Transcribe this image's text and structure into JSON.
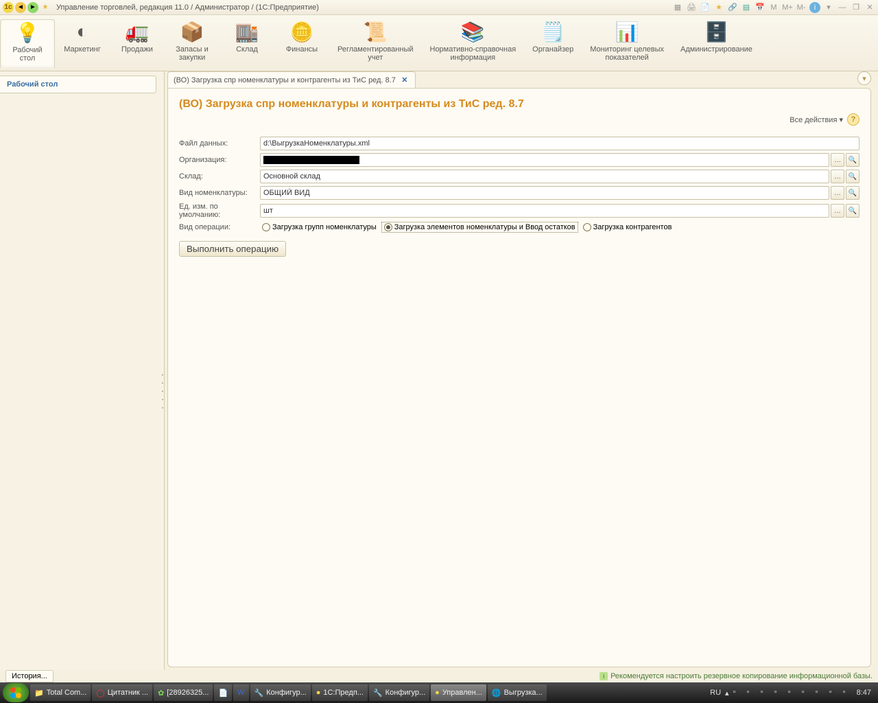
{
  "titlebar": {
    "title": "Управление торговлей, редакция 11.0 / Администратор / (1С:Предприятие)",
    "m_buttons": [
      "M",
      "M+",
      "M-"
    ]
  },
  "ribbon": [
    {
      "label": "Рабочий\nстол",
      "icon": "🔵",
      "active": true
    },
    {
      "label": "Маркетинг",
      "icon": "📊"
    },
    {
      "label": "Продажи",
      "icon": "🚚"
    },
    {
      "label": "Запасы и\nзакупки",
      "icon": "📦"
    },
    {
      "label": "Склад",
      "icon": "🏢"
    },
    {
      "label": "Финансы",
      "icon": "💰"
    },
    {
      "label": "Регламентированный\nучет",
      "icon": "📋"
    },
    {
      "label": "Нормативно-справочная\nинформация",
      "icon": "📚"
    },
    {
      "label": "Органайзер",
      "icon": "📝"
    },
    {
      "label": "Мониторинг целевых\nпоказателей",
      "icon": "📈"
    },
    {
      "label": "Администрирование",
      "icon": "🗄️"
    }
  ],
  "sidebar": {
    "active_tab": "Рабочий стол"
  },
  "tab": {
    "title": "(ВО) Загрузка спр номенклатуры и контрагенты из ТиС ред. 8.7"
  },
  "form": {
    "heading": "(ВО) Загрузка спр номенклатуры и контрагенты из ТиС ред. 8.7",
    "all_actions": "Все действия",
    "labels": {
      "file": "Файл данных:",
      "org": "Организация:",
      "warehouse": "Склад:",
      "nomenclature_type": "Вид номенклатуры:",
      "default_unit": "Ед. изм. по умолчанию:",
      "operation_type": "Вид операции:"
    },
    "values": {
      "file": "d:\\ВыгрузкаНоменклатуры.xml",
      "org": "",
      "warehouse": "Основной склад",
      "nomenclature_type": "ОБЩИЙ ВИД",
      "default_unit": "шт"
    },
    "radios": {
      "r1": "Загрузка групп номенклатуры",
      "r2": "Загрузка элементов номенклатуры и Ввод остатков",
      "r3": "Загрузка контрагентов",
      "selected": "r2"
    },
    "execute": "Выполнить операцию"
  },
  "status": {
    "history": "История...",
    "tip": "Рекомендуется настроить резервное копирование информационной базы."
  },
  "taskbar": {
    "items": [
      {
        "label": "Total Com...",
        "icon": "📁"
      },
      {
        "label": "Цитатник ...",
        "icon": "🔴"
      },
      {
        "label": "[28926325...",
        "icon": "💬"
      },
      {
        "label": "",
        "icon": "📄"
      },
      {
        "label": "",
        "icon": "📘"
      },
      {
        "label": "Конфигур...",
        "icon": "🔧"
      },
      {
        "label": "1С:Предп...",
        "icon": "🟡"
      },
      {
        "label": "Конфигур...",
        "icon": "🔧"
      },
      {
        "label": "Управлен...",
        "icon": "🟡",
        "active": true
      },
      {
        "label": "Выгрузка...",
        "icon": "🌐"
      }
    ],
    "lang": "RU",
    "time": "8:47"
  }
}
